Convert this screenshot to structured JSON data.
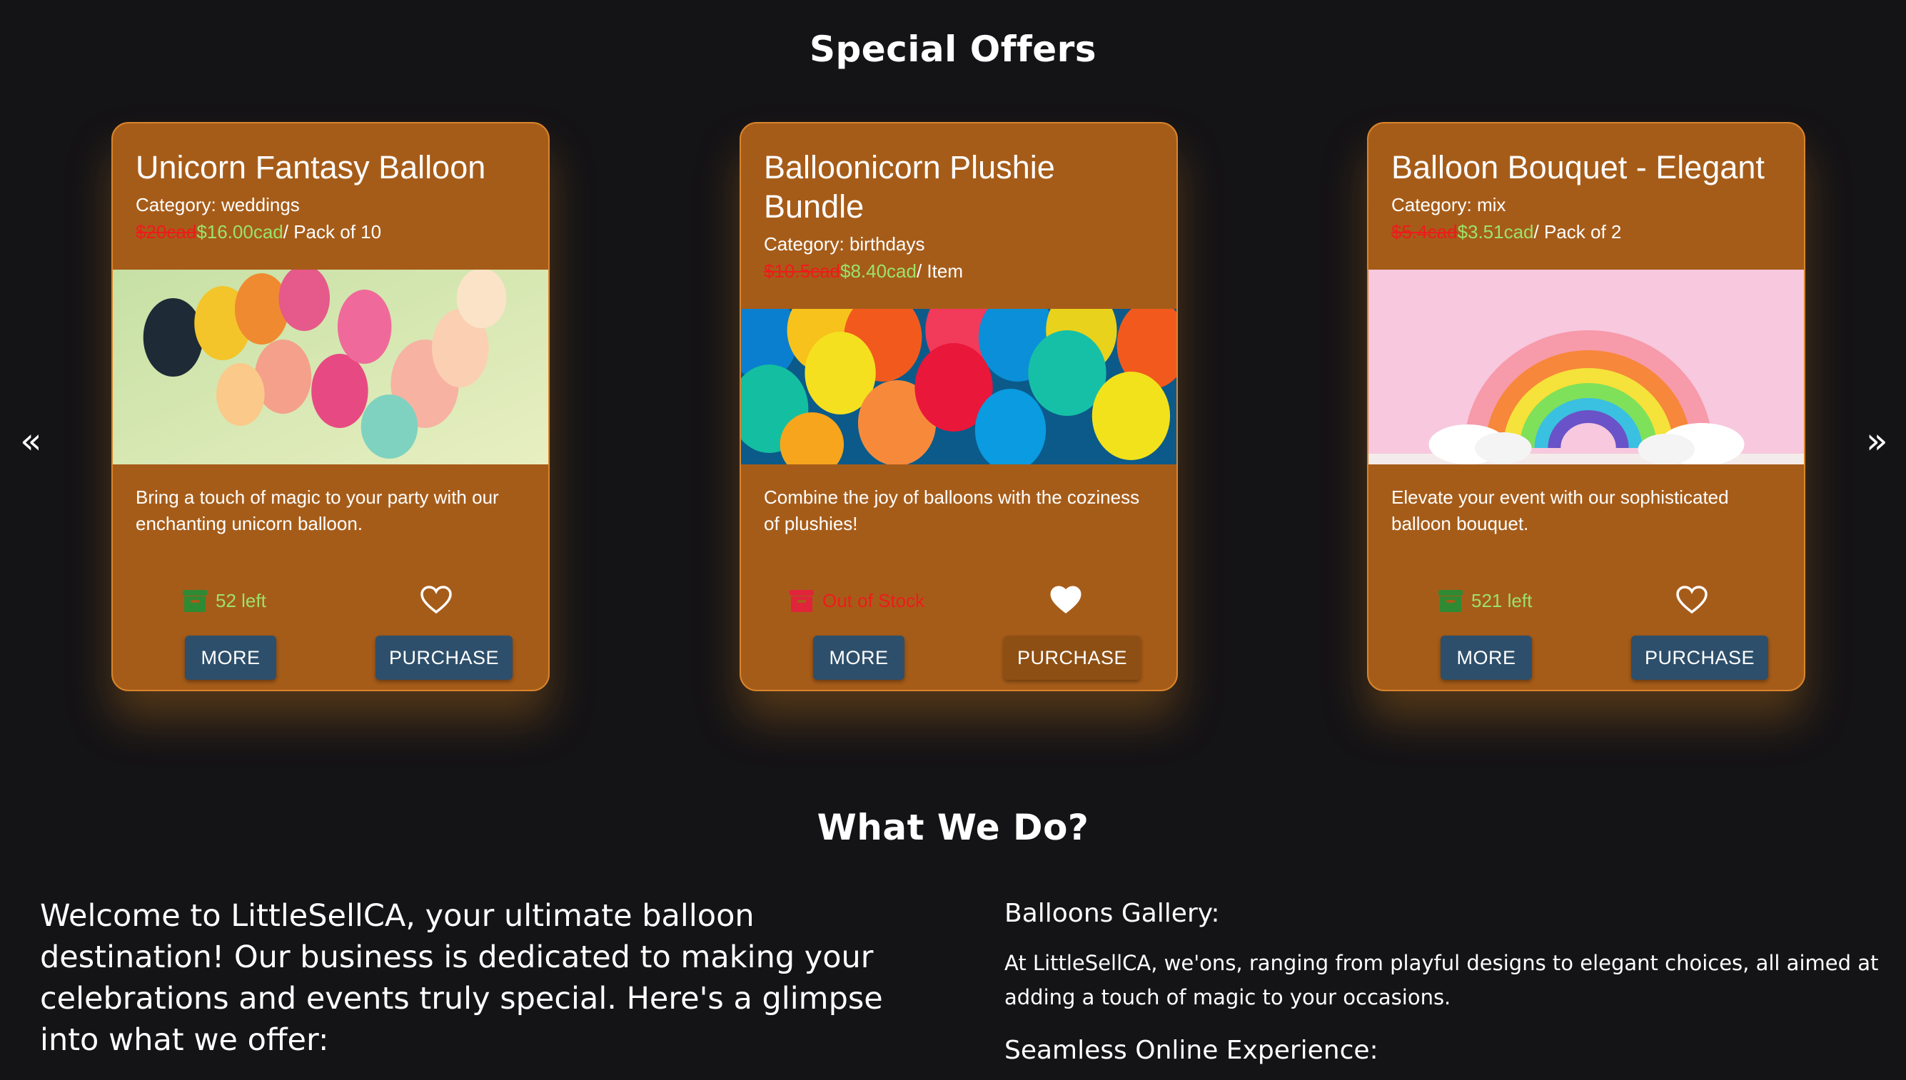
{
  "offers": {
    "title": "Special Offers",
    "prev_arrow": "«",
    "next_arrow": "»",
    "cards": [
      {
        "title": "Unicorn Fantasy Balloon",
        "category": "Category: weddings",
        "old_price": "$20cad",
        "new_price": "$16.00cad",
        "unit": "/ Pack of 10",
        "description": "Bring a touch of magic to your party with our enchanting unicorn balloon.",
        "stock": "52 left",
        "stock_status": "in-stock",
        "favorited": false,
        "more": "MORE",
        "purchase": "PURCHASE"
      },
      {
        "title": "Balloonicorn Plushie Bundle",
        "category": "Category: birthdays",
        "old_price": "$10.5cad",
        "new_price": "$8.40cad",
        "unit": "/ Item",
        "description": "Combine the joy of balloons with the coziness of plushies!",
        "stock": "Out of Stock",
        "stock_status": "out-of-stock",
        "favorited": true,
        "more": "MORE",
        "purchase": "PURCHASE"
      },
      {
        "title": "Balloon Bouquet - Elegant",
        "category": "Category: mix",
        "old_price": "$5.4cad",
        "new_price": "$3.51cad",
        "unit": "/ Pack of 2",
        "description": "Elevate your event with our sophisticated balloon bouquet.",
        "stock": "521 left",
        "stock_status": "in-stock",
        "favorited": false,
        "more": "MORE",
        "purchase": "PURCHASE"
      }
    ]
  },
  "about": {
    "title": "What We Do?",
    "intro": "Welcome to LittleSellCA, your ultimate balloon destination! Our business is dedicated to making your celebrations and events truly special. Here's a glimpse into what we offer:",
    "gallery_title": "Balloons Gallery:",
    "gallery_text": "At LittleSellCA, we'ons, ranging from playful designs to elegant choices, all aimed at adding a touch of magic to your occasions.",
    "seamless_title": "Seamless Online Experience:"
  },
  "colors": {
    "background": "#141316",
    "card": "#a65c19",
    "button": "#2d4f6b",
    "old_price": "#ee1b1b",
    "new_price": "#9be36a"
  }
}
